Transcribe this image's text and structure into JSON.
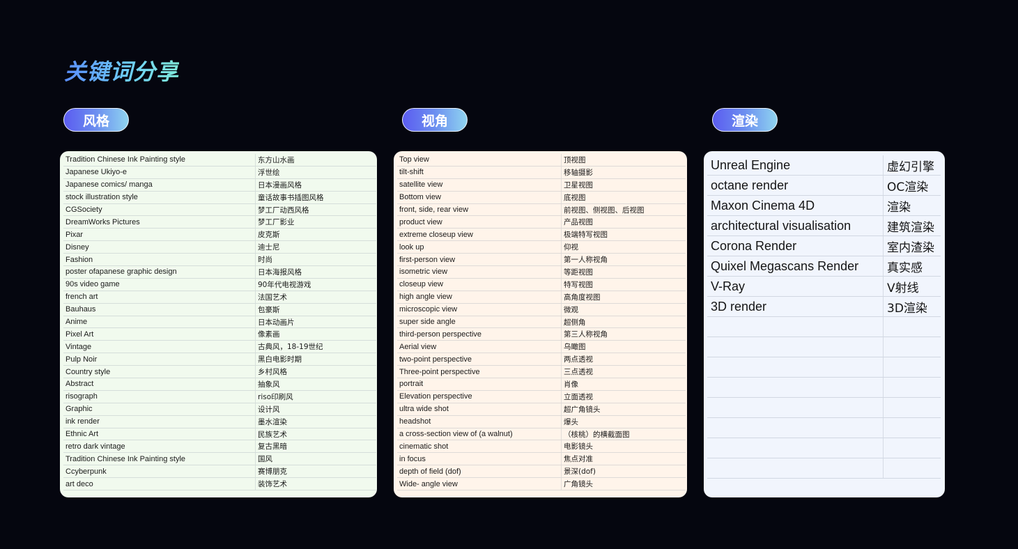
{
  "title": "关键词分享",
  "sections": {
    "style": {
      "label": "风格",
      "rows": [
        [
          "Tradition Chinese Ink Painting style",
          "东方山水画"
        ],
        [
          "Japanese Ukiyo-e",
          "浮世绘"
        ],
        [
          "Japanese comics/ manga",
          "日本漫画风格"
        ],
        [
          "stock illustration style",
          "童话故事书插图风格"
        ],
        [
          "CGSociety",
          "梦工厂动西风格"
        ],
        [
          "DreamWorks Pictures",
          "梦工厂影业"
        ],
        [
          "Pixar",
          "皮克斯"
        ],
        [
          "Disney",
          "迪士尼"
        ],
        [
          "Fashion",
          "时尚"
        ],
        [
          "poster ofapanese graphic design",
          "日本海报风格"
        ],
        [
          "90s video game",
          "90年代电视游戏"
        ],
        [
          "french art",
          "法国艺术"
        ],
        [
          "Bauhaus",
          "包豪斯"
        ],
        [
          "Anime",
          "日本动画片"
        ],
        [
          "Pixel Art",
          "像素画"
        ],
        [
          "Vintage",
          "古典风，18-19世纪"
        ],
        [
          "Pulp Noir",
          "黑白电影时期"
        ],
        [
          "Country style",
          "乡村风格"
        ],
        [
          "Abstract",
          "抽象风"
        ],
        [
          "risograph",
          "riso印刷风"
        ],
        [
          "Graphic",
          "设计风"
        ],
        [
          "ink render",
          "墨水渲染"
        ],
        [
          "Ethnic Art",
          "民族艺术"
        ],
        [
          "retro dark vintage",
          "复古黑暗"
        ],
        [
          "Tradition Chinese Ink Painting style",
          "国风"
        ],
        [
          "Ccyberpunk",
          "赛博朋克"
        ],
        [
          "art deco",
          "装饰艺术"
        ]
      ]
    },
    "view": {
      "label": "视角",
      "rows": [
        [
          "Top view",
          "顶视图"
        ],
        [
          "tilt-shift",
          "移轴摄影"
        ],
        [
          "satellite view",
          "卫星视图"
        ],
        [
          "Bottom view",
          "底视图"
        ],
        [
          "front, side, rear view",
          "前视图、侧视图、后视图"
        ],
        [
          "product view",
          "产品视图"
        ],
        [
          "extreme closeup view",
          "极端特写视图"
        ],
        [
          "look up",
          "仰视"
        ],
        [
          "first-person view",
          "第一人称视角"
        ],
        [
          "isometric view",
          "等距视图"
        ],
        [
          "closeup view",
          "特写视图"
        ],
        [
          "high angle view",
          "高角度视图"
        ],
        [
          "microscopic view",
          "微观"
        ],
        [
          "super side angle",
          "超侧角"
        ],
        [
          "third-person perspective",
          "第三人称视角"
        ],
        [
          "Aerial view",
          "乌瞰图"
        ],
        [
          "two-point perspective",
          "两点透视"
        ],
        [
          "Three-point perspective",
          "三点透视"
        ],
        [
          "portrait",
          "肖像"
        ],
        [
          "Elevation perspective",
          "立面透视"
        ],
        [
          "ultra wide shot",
          "超广角镜头"
        ],
        [
          "headshot",
          "爆头"
        ],
        [
          "a cross-section view of (a walnut)",
          "（核桃）的横截面图"
        ],
        [
          "cinematic shot",
          "电影镜头"
        ],
        [
          "in focus",
          "焦点对准"
        ],
        [
          "depth of field (dof)",
          "景深(dof)"
        ],
        [
          "Wide- angle view",
          "广角镜头"
        ]
      ]
    },
    "render": {
      "label": "渲染",
      "rows": [
        [
          "Unreal Engine",
          "虚幻引擎"
        ],
        [
          "octane render",
          "OC渲染"
        ],
        [
          "Maxon Cinema 4D",
          "渲染"
        ],
        [
          "architectural visualisation",
          "建筑渲染"
        ],
        [
          "Corona Render",
          "室内渣染"
        ],
        [
          "Quixel Megascans Render",
          "真实感"
        ],
        [
          "V-Ray",
          "V射线"
        ],
        [
          "3D render",
          "3D渲染"
        ],
        [
          "",
          ""
        ],
        [
          "",
          ""
        ],
        [
          "",
          ""
        ],
        [
          "",
          ""
        ],
        [
          "",
          ""
        ],
        [
          "",
          ""
        ],
        [
          "",
          ""
        ],
        [
          "",
          ""
        ]
      ]
    }
  }
}
